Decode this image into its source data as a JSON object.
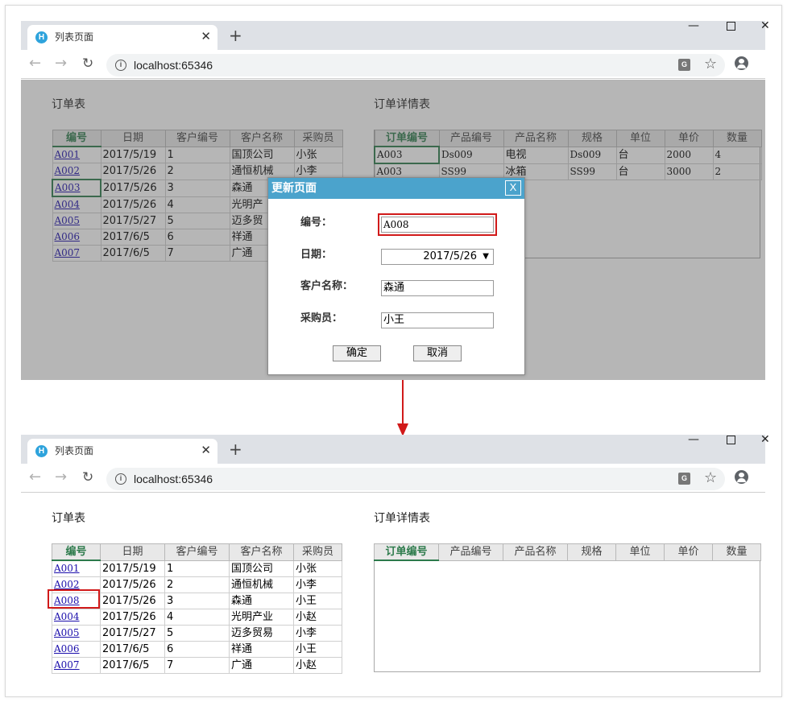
{
  "browser": {
    "tab_title": "列表页面",
    "tab_favicon": "H",
    "tab_close": "✕",
    "new_tab": "+",
    "url": "localhost:65346",
    "icons": {
      "back": "back-arrow-icon",
      "forward": "forward-arrow-icon",
      "reload": "reload-icon",
      "info": "info-icon",
      "translate": "translate-icon",
      "star": "star-icon",
      "account": "account-icon"
    }
  },
  "orders": {
    "title": "订单表",
    "columns": [
      "编号",
      "日期",
      "客户编号",
      "客户名称",
      "采购员"
    ]
  },
  "order_details": {
    "title": "订单详情表",
    "columns": [
      "订单编号",
      "产品编号",
      "产品名称",
      "规格",
      "单位",
      "单价",
      "数量"
    ]
  },
  "before": {
    "order_rows": [
      [
        "A001",
        "2017/5/19",
        "1",
        "国顶公司",
        "小张"
      ],
      [
        "A002",
        "2017/5/26",
        "2",
        "通恒机械",
        "小李"
      ],
      [
        "A003",
        "2017/5/26",
        "3",
        "森通",
        ""
      ],
      [
        "A004",
        "2017/5/26",
        "4",
        "光明产",
        ""
      ],
      [
        "A005",
        "2017/5/27",
        "5",
        "迈多贸",
        ""
      ],
      [
        "A006",
        "2017/6/5",
        "6",
        "祥通",
        ""
      ],
      [
        "A007",
        "2017/6/5",
        "7",
        "广通",
        ""
      ]
    ],
    "detail_rows": [
      [
        "A003",
        "Ds009",
        "电视",
        "Ds009",
        "台",
        "2000",
        "4"
      ],
      [
        "A003",
        "SS99",
        "冰箱",
        "SS99",
        "台",
        "3000",
        "2"
      ]
    ]
  },
  "dialog": {
    "title": "更新页面",
    "close": "X",
    "fields": [
      {
        "label": "编号：",
        "value": "A008"
      },
      {
        "label": "日期：",
        "value": "2017/5/26"
      },
      {
        "label": "客户名称：",
        "value": "森通"
      },
      {
        "label": "采购员：",
        "value": "小王"
      }
    ],
    "ok_label": "确定",
    "cancel_label": "取消"
  },
  "after": {
    "order_rows": [
      [
        "A001",
        "2017/5/19",
        "1",
        "国顶公司",
        "小张"
      ],
      [
        "A002",
        "2017/5/26",
        "2",
        "通恒机械",
        "小李"
      ],
      [
        "A008",
        "2017/5/26",
        "3",
        "森通",
        "小王"
      ],
      [
        "A004",
        "2017/5/26",
        "4",
        "光明产业",
        "小赵"
      ],
      [
        "A005",
        "2017/5/27",
        "5",
        "迈多贸易",
        "小李"
      ],
      [
        "A006",
        "2017/6/5",
        "6",
        "祥通",
        "小王"
      ],
      [
        "A007",
        "2017/6/5",
        "7",
        "广通",
        "小赵"
      ]
    ]
  },
  "colors": {
    "highlight": "#d11a1a",
    "dialog_title_bg": "#4ba3cc",
    "key_header": "#2c7a4b",
    "link": "#1a0dab"
  }
}
